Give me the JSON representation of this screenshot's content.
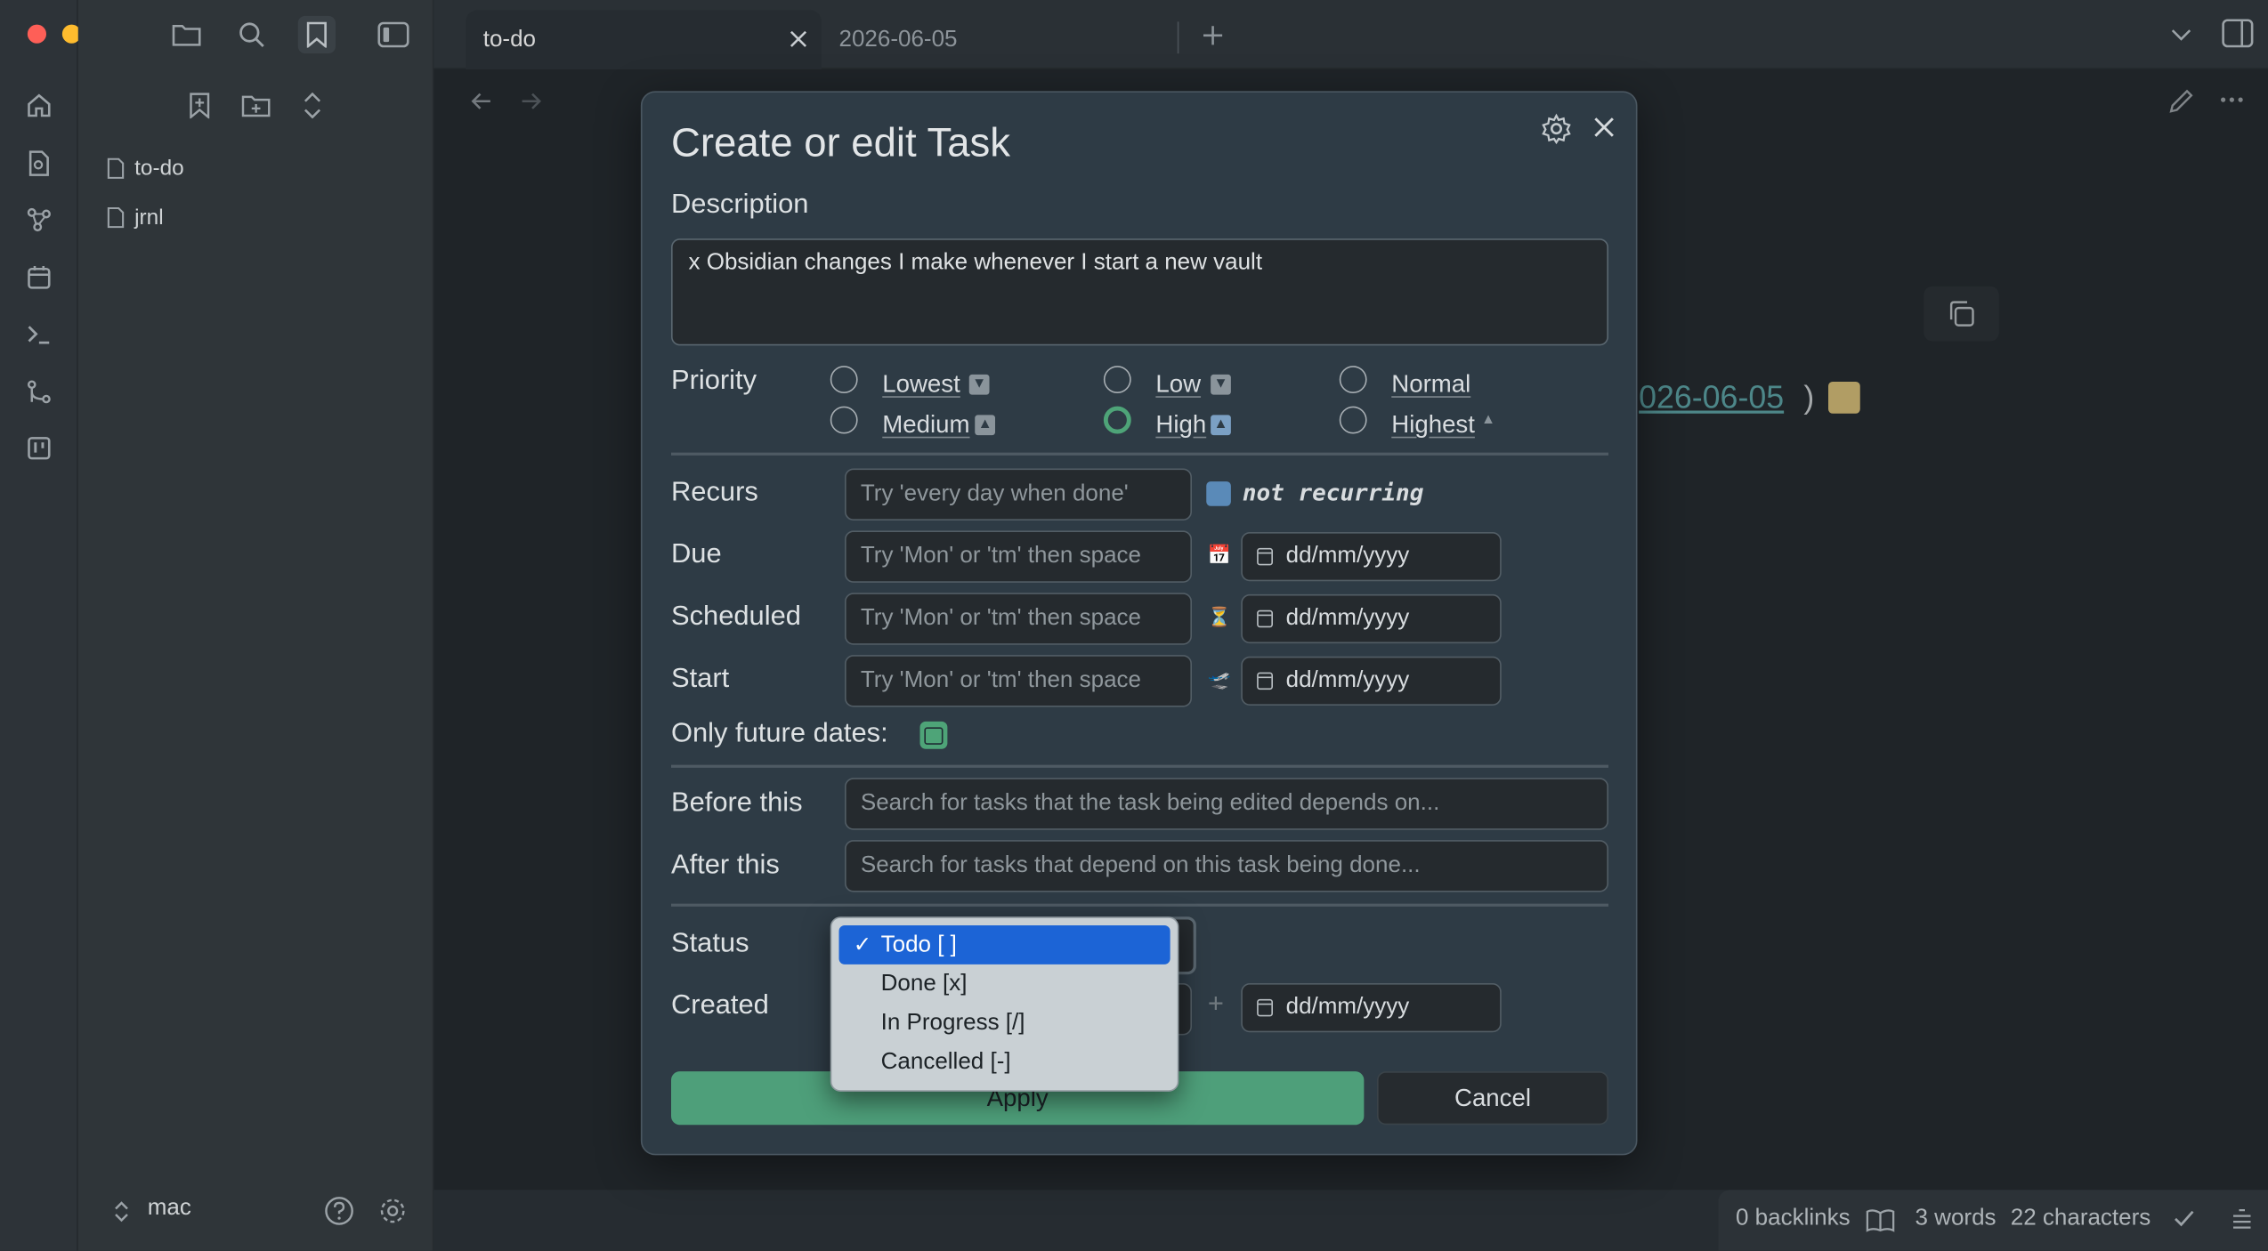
{
  "sidebar": {
    "files": [
      {
        "label": "to-do"
      },
      {
        "label": "jrnl"
      }
    ],
    "vault_name": "mac"
  },
  "tabs": [
    {
      "label": "to-do",
      "active": true
    },
    {
      "label": "2026-06-05",
      "active": false
    }
  ],
  "background": {
    "link_text": "026-06-05",
    "paren": ")"
  },
  "status_bar": {
    "backlinks": "0 backlinks",
    "words": "3 words",
    "characters": "22 characters"
  },
  "modal": {
    "title": "Create or edit Task",
    "description_label": "Description",
    "description_value": "x Obsidian changes I make whenever I start a new vault",
    "priority_label": "Priority",
    "priorities": [
      {
        "label": "Lowest",
        "icon": "⏬",
        "checked": false
      },
      {
        "label": "Low",
        "icon": "🔽",
        "checked": false
      },
      {
        "label": "Normal",
        "icon": "",
        "checked": false
      },
      {
        "label": "Medium",
        "icon": "🔼",
        "checked": false
      },
      {
        "label": "High",
        "icon": "⏫",
        "checked": true
      },
      {
        "label": "Highest",
        "icon": "🔺",
        "checked": false
      }
    ],
    "recurs_label": "Recurs",
    "recurs_placeholder": "Try 'every day when done'",
    "recurs_value": "not recurring",
    "due_label": "Due",
    "due_placeholder": "Try 'Mon' or 'tm' then space",
    "scheduled_label": "Scheduled",
    "scheduled_placeholder": "Try 'Mon' or 'tm' then space",
    "start_label": "Start",
    "start_placeholder": "Try 'Mon' or 'tm' then space",
    "date_format": "dd/mm/yyyy",
    "future_dates_label": "Only future dates:",
    "future_dates_checked": true,
    "before_label": "Before this",
    "before_placeholder": "Search for tasks that the task being edited depends on...",
    "after_label": "After this",
    "after_placeholder": "Search for tasks that depend on this task being done...",
    "status_label": "Status",
    "created_label": "Created",
    "apply_label": "Apply",
    "cancel_label": "Cancel"
  },
  "status_dropdown": {
    "options": [
      {
        "label": "Todo [ ]",
        "selected": true
      },
      {
        "label": "Done [x]",
        "selected": false
      },
      {
        "label": "In Progress [/]",
        "selected": false
      },
      {
        "label": "Cancelled [-]",
        "selected": false
      }
    ],
    "check_mark": "✓"
  },
  "colors": {
    "accent": "#4ea478",
    "selection": "#1c64d6",
    "modal_bg": "#2e3b45"
  }
}
